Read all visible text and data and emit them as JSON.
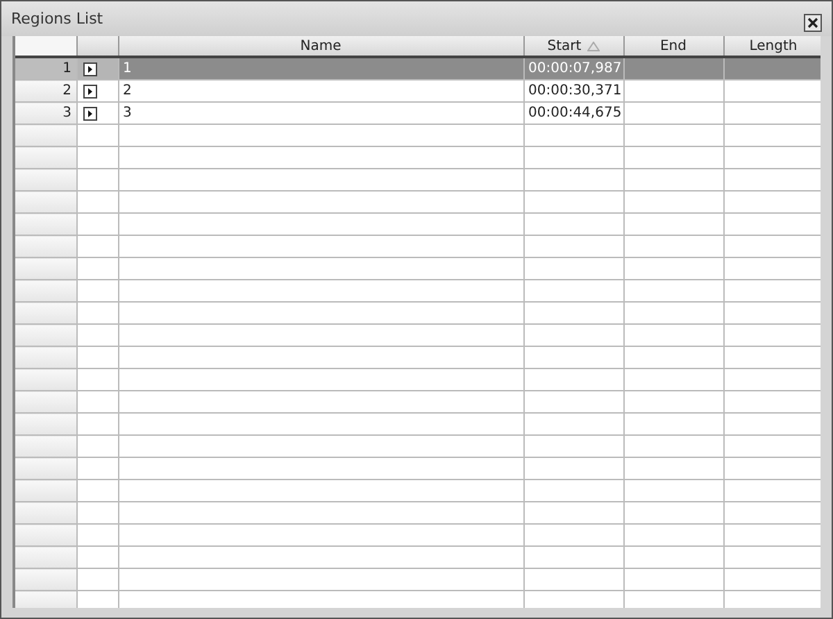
{
  "window": {
    "title": "Regions List"
  },
  "table": {
    "columns": [
      {
        "label": "Name",
        "sorted": false
      },
      {
        "label": "Start",
        "sorted": true
      },
      {
        "label": "End",
        "sorted": false
      },
      {
        "label": "Length",
        "sorted": false
      }
    ],
    "rows": [
      {
        "number": "1",
        "selected": true,
        "name": "1",
        "start": "00:00:07,987"
      },
      {
        "number": "2",
        "selected": false,
        "name": "2",
        "start": "00:00:30,371"
      },
      {
        "number": "3",
        "selected": false,
        "name": "3",
        "start": "00:00:44,675"
      }
    ]
  }
}
